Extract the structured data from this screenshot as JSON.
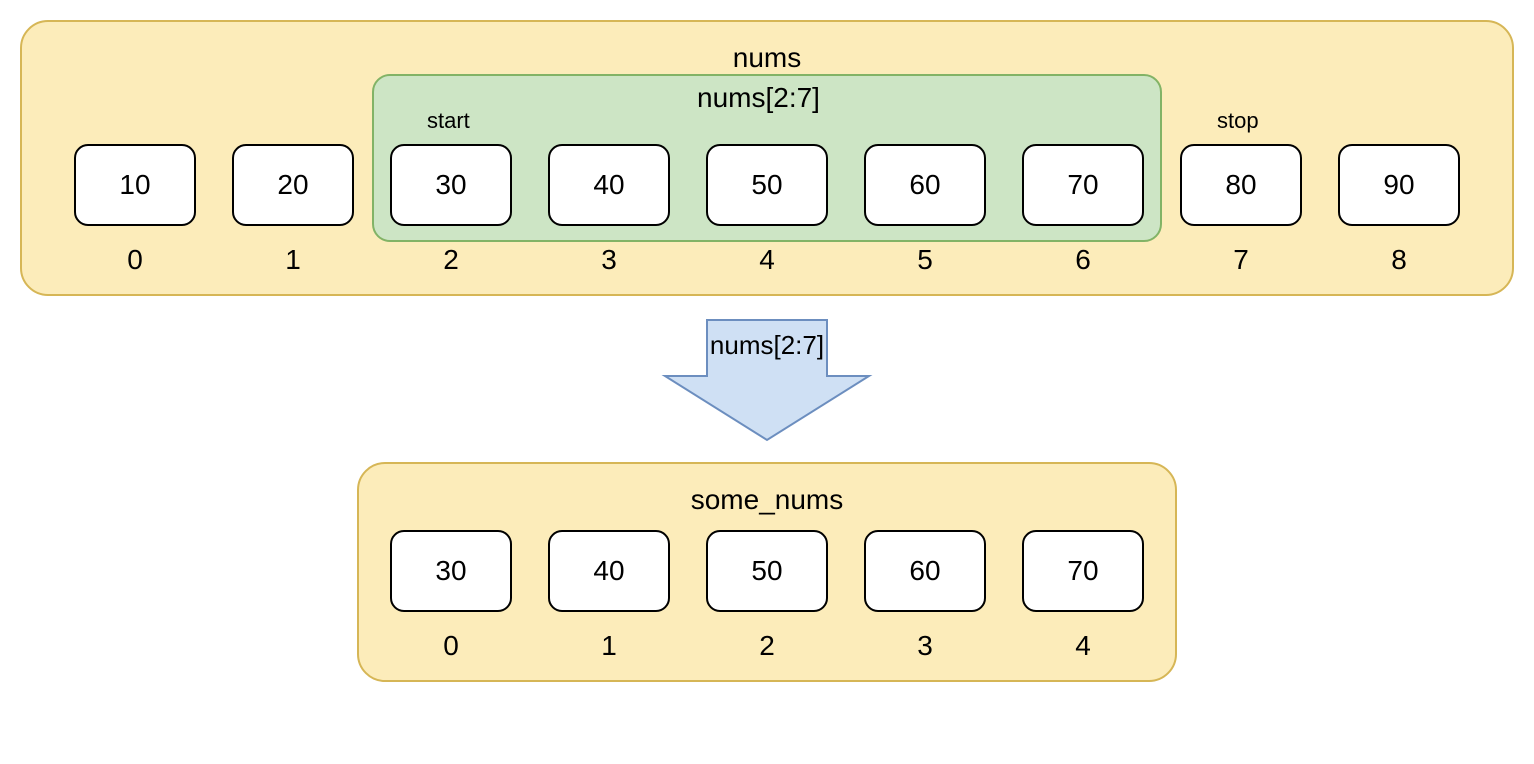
{
  "nums": {
    "title": "nums",
    "slice_label": "nums[2:7]",
    "start_label": "start",
    "stop_label": "stop",
    "values": [
      "10",
      "20",
      "30",
      "40",
      "50",
      "60",
      "70",
      "80",
      "90"
    ],
    "indices": [
      "0",
      "1",
      "2",
      "3",
      "4",
      "5",
      "6",
      "7",
      "8"
    ],
    "slice_start_index": 2,
    "slice_stop_index": 7
  },
  "arrow": {
    "label": "nums[2:7]"
  },
  "some_nums": {
    "title": "some_nums",
    "values": [
      "30",
      "40",
      "50",
      "60",
      "70"
    ],
    "indices": [
      "0",
      "1",
      "2",
      "3",
      "4"
    ]
  }
}
